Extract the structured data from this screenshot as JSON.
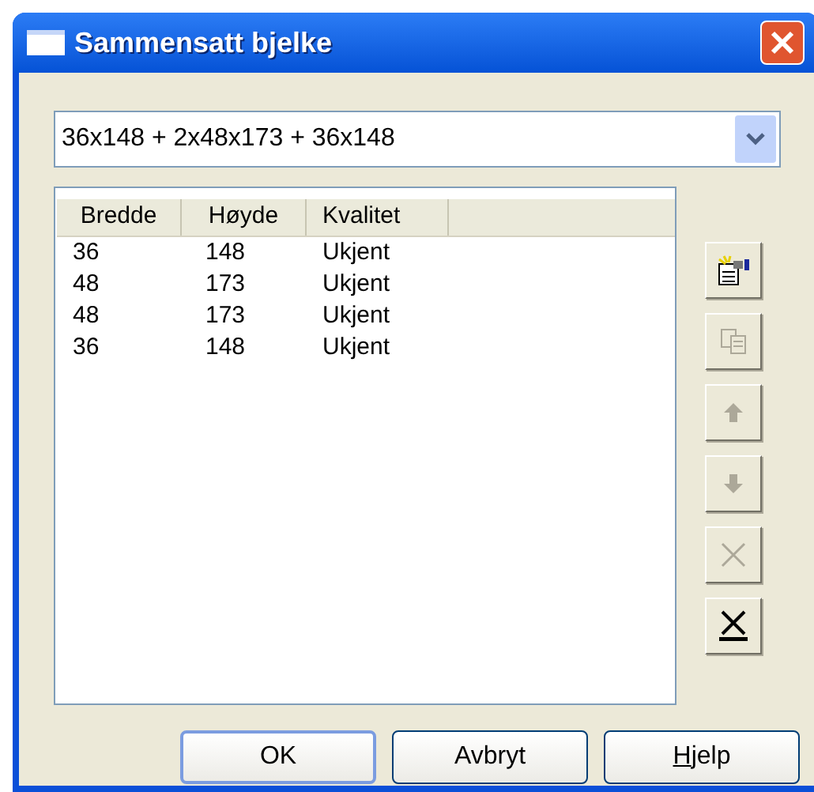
{
  "window": {
    "title": "Sammensatt bjelke"
  },
  "combo": {
    "value": "36x148 + 2x48x173 + 36x148"
  },
  "table": {
    "columns": [
      "Bredde",
      "Høyde",
      "Kvalitet"
    ],
    "rows": [
      [
        "36",
        "148",
        "Ukjent"
      ],
      [
        "48",
        "173",
        "Ukjent"
      ],
      [
        "48",
        "173",
        "Ukjent"
      ],
      [
        "36",
        "148",
        "Ukjent"
      ]
    ]
  },
  "tools": [
    {
      "kind": "new",
      "disabled": false
    },
    {
      "kind": "copy",
      "disabled": true
    },
    {
      "kind": "up",
      "disabled": true
    },
    {
      "kind": "down",
      "disabled": true
    },
    {
      "kind": "delete",
      "disabled": true
    },
    {
      "kind": "clear",
      "disabled": false
    }
  ],
  "buttons": [
    {
      "label": "OK",
      "default": true,
      "mnemonic": false
    },
    {
      "label": "Avbryt",
      "default": false,
      "mnemonic": false
    },
    {
      "label": "Hjelp",
      "default": false,
      "mnemonic": true
    }
  ]
}
